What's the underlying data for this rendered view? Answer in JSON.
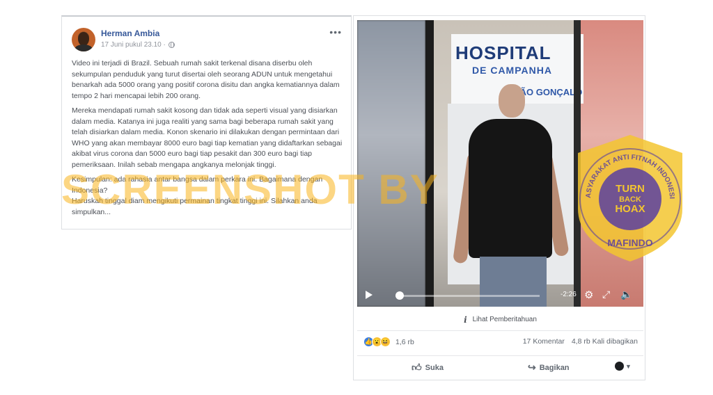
{
  "post": {
    "author": "Herman Ambia",
    "timestamp": "17 Juni pukul 23.10 ·",
    "more_label": "•••",
    "paragraphs": [
      "Video ini terjadi di Brazil. Sebuah rumah sakit terkenal disana diserbu oleh sekumpulan penduduk yang turut disertai oleh seorang ADUN untuk mengetahui benarkah ada 5000 orang yang positif corona disitu dan angka kematiannya dalam tempo 2 hari mencapai lebih 200 orang.",
      "Mereka mendapati rumah sakit kosong dan tidak ada seperti visual yang disiarkan dalam media. Katanya ini juga realiti yang sama bagi beberapa rumah sakit yang telah disiarkan dalam media. Konon skenario ini dilakukan dengan permintaan dari WHO yang akan membayar 8000 euro bagi tiap kematian yang didaftarkan sebagai akibat virus corona dan 5000 euro bagi tiap pesakit dan 300 euro bagi tiap pemeriksaan. Inilah sebab mengapa angkanya melonjak tinggi.",
      "Kesimpulan: ada rahasia antar bangsa dalam perkara ini. Bagaimana dengan Indonesia?\nHaruskah tinggal diam mengikuti permainan tingkat tinggi ini. Silahkan anda simpulkan..."
    ]
  },
  "watermark": "SCREENSHOT BY",
  "video": {
    "sign_title": "HOSPITAL",
    "sign_sub": "DE CAMPANHA",
    "sign_sub2": "SÃO GONÇALO",
    "time_remaining": "-2:26",
    "progress": 0.03,
    "icons": [
      "play-icon",
      "gear-icon",
      "expand-icon",
      "volume-icon"
    ]
  },
  "notice": {
    "label": "Lihat Pemberitahuan"
  },
  "stats": {
    "reaction_count": "1,6 rb",
    "comments": "17 Komentar",
    "shares": "4,8 rb Kali dibagikan"
  },
  "actions": {
    "like_label": "Suka",
    "share_label": "Bagikan"
  },
  "badge": {
    "arc_text": "MASYARAKAT ANTI FITNAH INDONESIA",
    "line1": "TURN",
    "line2": "BACK",
    "line3": "HOAX",
    "bottom": "MAFINDO"
  },
  "colors": {
    "link": "#365899",
    "watermark": "#fab41e",
    "badge_gold": "#f3c530",
    "badge_purple": "#5a3fa0"
  }
}
